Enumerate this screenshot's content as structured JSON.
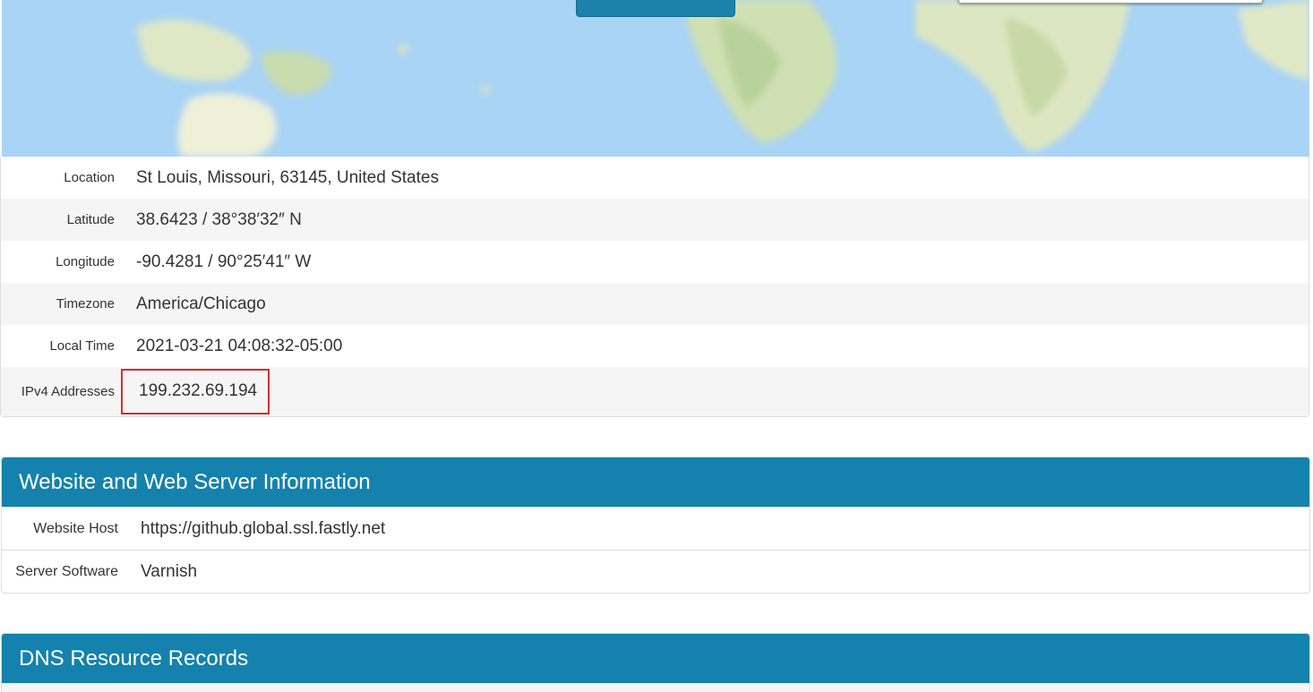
{
  "geo": {
    "rows": [
      {
        "label": "Location",
        "value": "St Louis, Missouri, 63145, United States"
      },
      {
        "label": "Latitude",
        "value": "38.6423 / 38°38′32″ N"
      },
      {
        "label": "Longitude",
        "value": "-90.4281 / 90°25′41″ W"
      },
      {
        "label": "Timezone",
        "value": "America/Chicago"
      },
      {
        "label": "Local Time",
        "value": "2021-03-21 04:08:32-05:00"
      },
      {
        "label": "IPv4 Addresses",
        "value": "199.232.69.194"
      }
    ]
  },
  "web": {
    "title": "Website and Web Server Information",
    "rows": [
      {
        "label": "Website Host",
        "value": "https://github.global.ssl.fastly.net"
      },
      {
        "label": "Server Software",
        "value": "Varnish"
      }
    ]
  },
  "dns": {
    "title": "DNS Resource Records"
  },
  "colors": {
    "panel_header": "#1482ad",
    "highlight_border": "#d32f2f",
    "map_water": "#a9d4f6"
  }
}
